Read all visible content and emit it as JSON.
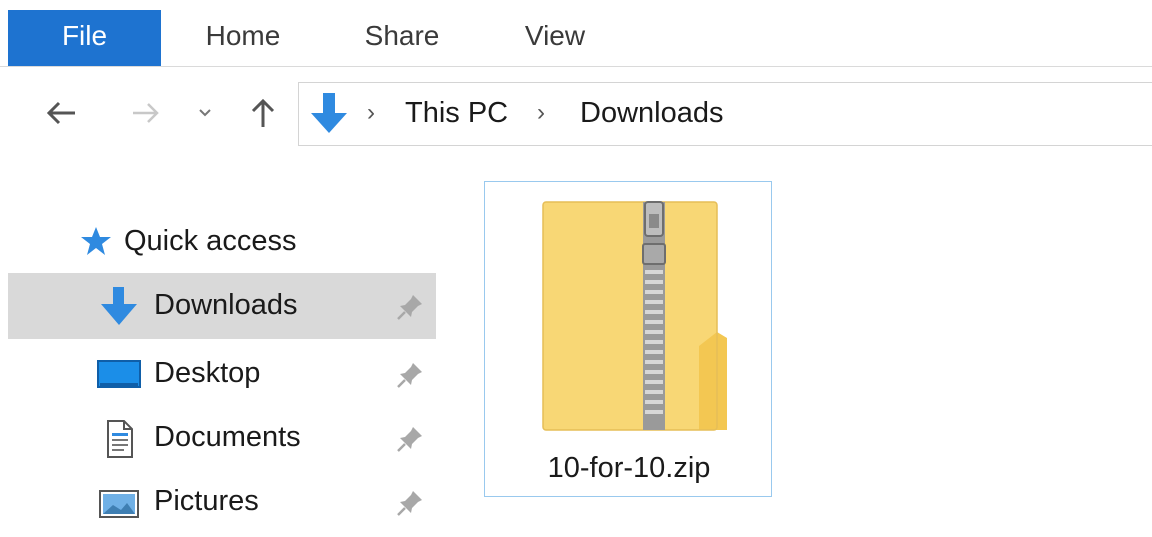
{
  "ribbon": {
    "tabs": [
      {
        "label": "File",
        "active": true
      },
      {
        "label": "Home"
      },
      {
        "label": "Share"
      },
      {
        "label": "View"
      }
    ]
  },
  "navigation": {
    "back_icon": "arrow-left-icon",
    "forward_icon": "arrow-right-icon",
    "recent_icon": "chevron-down-icon",
    "up_icon": "arrow-up-icon",
    "address": {
      "location_icon": "downloads-icon",
      "separator": "›",
      "crumbs": [
        "This PC",
        "Downloads"
      ]
    }
  },
  "navpane": {
    "quick_access_label": "Quick access",
    "items": [
      {
        "label": "Downloads",
        "icon": "downloads-icon",
        "selected": true,
        "pinned": true
      },
      {
        "label": "Desktop",
        "icon": "desktop-icon",
        "pinned": true
      },
      {
        "label": "Documents",
        "icon": "documents-icon",
        "pinned": true
      },
      {
        "label": "Pictures",
        "icon": "pictures-icon",
        "pinned": true
      }
    ]
  },
  "content": {
    "files": [
      {
        "name": "10-for-10.zip",
        "icon": "zip-folder-icon",
        "selected": true
      }
    ]
  },
  "colors": {
    "accent": "#1e73d0",
    "selection_bg": "#d9d9d9",
    "file_selection_border": "#99c9ee",
    "folder_yellow": "#f8d775"
  }
}
